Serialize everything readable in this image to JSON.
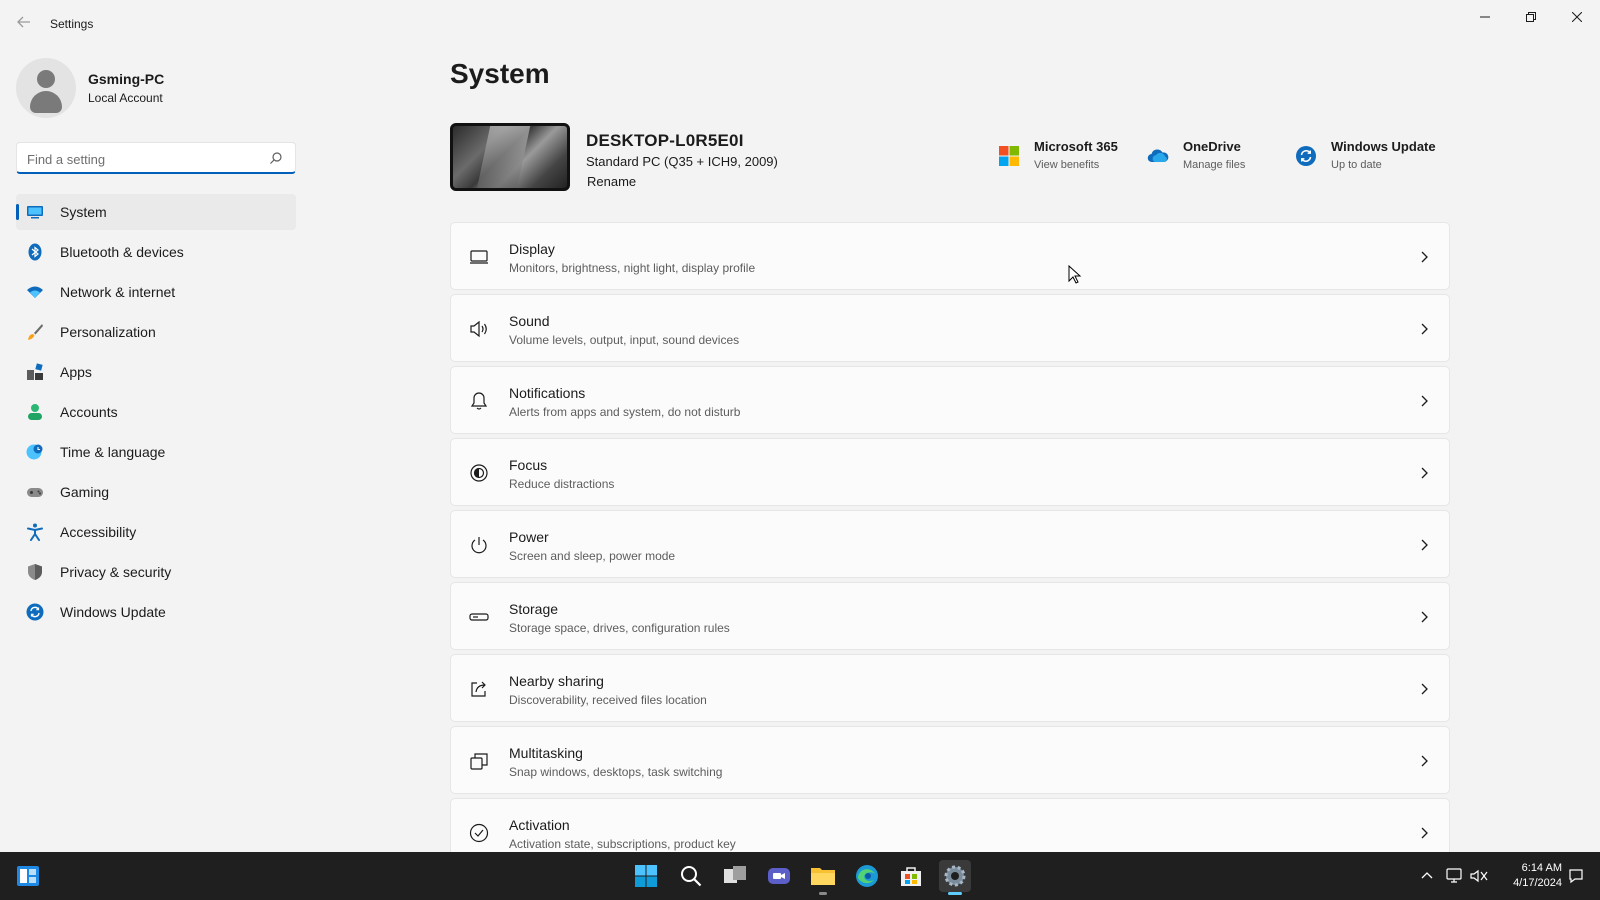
{
  "window": {
    "app_title": "Settings",
    "back_icon": "back-arrow-icon",
    "minimize_icon": "minimize-icon",
    "maximize_icon": "restore-icon",
    "close_icon": "close-icon"
  },
  "profile": {
    "name": "Gsming-PC",
    "account_type": "Local Account"
  },
  "search": {
    "placeholder": "Find a setting",
    "value": ""
  },
  "sidebar": {
    "selected": "System",
    "items": [
      {
        "label": "System",
        "icon": "system-icon"
      },
      {
        "label": "Bluetooth & devices",
        "icon": "bluetooth-icon"
      },
      {
        "label": "Network & internet",
        "icon": "wifi-icon"
      },
      {
        "label": "Personalization",
        "icon": "brush-icon"
      },
      {
        "label": "Apps",
        "icon": "apps-icon"
      },
      {
        "label": "Accounts",
        "icon": "accounts-icon"
      },
      {
        "label": "Time & language",
        "icon": "globe-clock-icon"
      },
      {
        "label": "Gaming",
        "icon": "gamepad-icon"
      },
      {
        "label": "Accessibility",
        "icon": "accessibility-icon"
      },
      {
        "label": "Privacy & security",
        "icon": "shield-icon"
      },
      {
        "label": "Windows Update",
        "icon": "windows-update-icon"
      }
    ]
  },
  "main": {
    "title": "System",
    "device": {
      "name": "DESKTOP-L0R5E0I",
      "model": "Standard PC (Q35 + ICH9, 2009)",
      "rename_label": "Rename"
    },
    "quick_links": [
      {
        "title": "Microsoft 365",
        "subtitle": "View benefits",
        "icon": "microsoft-365-icon"
      },
      {
        "title": "OneDrive",
        "subtitle": "Manage files",
        "icon": "onedrive-icon"
      },
      {
        "title": "Windows Update",
        "subtitle": "Up to date",
        "icon": "windows-update-icon"
      }
    ],
    "cards": [
      {
        "title": "Display",
        "subtitle": "Monitors, brightness, night light, display profile",
        "icon": "display-icon"
      },
      {
        "title": "Sound",
        "subtitle": "Volume levels, output, input, sound devices",
        "icon": "speaker-icon"
      },
      {
        "title": "Notifications",
        "subtitle": "Alerts from apps and system, do not disturb",
        "icon": "bell-icon"
      },
      {
        "title": "Focus",
        "subtitle": "Reduce distractions",
        "icon": "focus-icon"
      },
      {
        "title": "Power",
        "subtitle": "Screen and sleep, power mode",
        "icon": "power-icon"
      },
      {
        "title": "Storage",
        "subtitle": "Storage space, drives, configuration rules",
        "icon": "storage-icon"
      },
      {
        "title": "Nearby sharing",
        "subtitle": "Discoverability, received files location",
        "icon": "share-icon"
      },
      {
        "title": "Multitasking",
        "subtitle": "Snap windows, desktops, task switching",
        "icon": "multitasking-icon"
      },
      {
        "title": "Activation",
        "subtitle": "Activation state, subscriptions, product key",
        "icon": "activation-check-icon"
      }
    ]
  },
  "taskbar": {
    "apps": [
      "widgets-icon",
      "start-icon",
      "search-icon",
      "task-view-icon",
      "chat-icon",
      "file-explorer-icon",
      "edge-icon",
      "store-icon",
      "settings-icon"
    ],
    "active_app": "settings-icon",
    "tray": [
      "chevron-up-icon",
      "network-icon",
      "volume-icon",
      "notification-icon"
    ],
    "time": "6:14 AM",
    "date": "4/17/2024"
  },
  "colors": {
    "accent": "#005fb8",
    "window_bg": "#f3f3f3",
    "card_bg": "#fbfbfb",
    "taskbar_bg": "#1f1f1f"
  }
}
